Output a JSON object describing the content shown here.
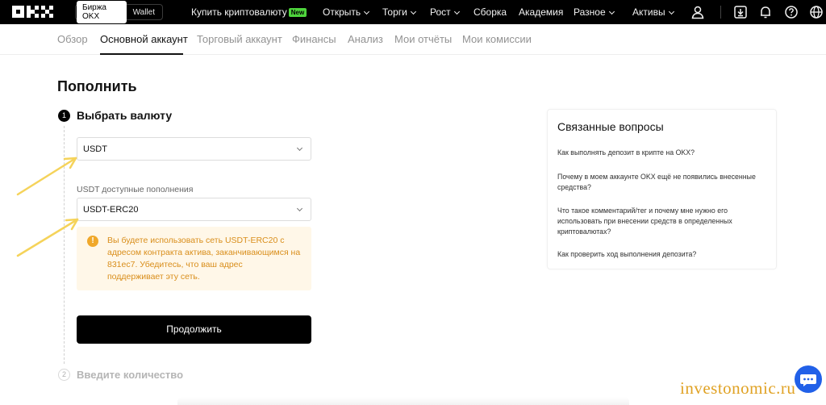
{
  "topbar": {
    "switch": {
      "exchange": "Биржа OKX",
      "wallet": "Wallet"
    },
    "nav": [
      {
        "label": "Купить криптовалюту",
        "badge": "New"
      },
      {
        "label": "Открыть"
      },
      {
        "label": "Торги"
      },
      {
        "label": "Рост"
      },
      {
        "label": "Сборка"
      },
      {
        "label": "Академия"
      },
      {
        "label": "Разное"
      },
      {
        "label": "Активы"
      }
    ],
    "icons": [
      "user-icon",
      "download-icon",
      "bell-icon",
      "help-icon",
      "globe-icon"
    ]
  },
  "subtabs": [
    "Обзор",
    "Основной аккаунт",
    "Торговый аккаунт",
    "Финансы",
    "Анализ",
    "Мои отчёты",
    "Мои комиссии"
  ],
  "main": {
    "title": "Пополнить",
    "step1": {
      "number": "1",
      "title": "Выбрать валюту"
    },
    "currency_select": {
      "value": "USDT"
    },
    "network_label": "USDT доступные пополнения",
    "network_select": {
      "value": "USDT-ERC20"
    },
    "warning": {
      "icon": "!",
      "text": "Вы будете использовать сеть USDT-ERC20 с адресом контракта актива, заканчивающимся на 831ec7. Убедитесь, что ваш адрес поддерживает эту сеть."
    },
    "continue_label": "Продолжить",
    "step2": {
      "number": "2",
      "title": "Введите количество"
    }
  },
  "faq": {
    "title": "Связанные вопросы",
    "items": [
      "Как выполнять депозит в крипте на OKX?",
      "Почему в моем аккаунте OKX ещё не появились внесенные средства?",
      "Что такое комментарий/тег и почему мне нужно его использовать при внесении средств в определенных криптовалютах?",
      "Как проверить ход выполнения депозита?"
    ]
  },
  "watermark": "investonomic.ru",
  "colors": {
    "topbar": "#000000",
    "accent_badge": "#4ed53c",
    "warning_bg": "#fff7e8",
    "warning_text": "#d98e1b",
    "annotation_arrow": "#f5d35a",
    "chat_button": "#2160e8"
  }
}
